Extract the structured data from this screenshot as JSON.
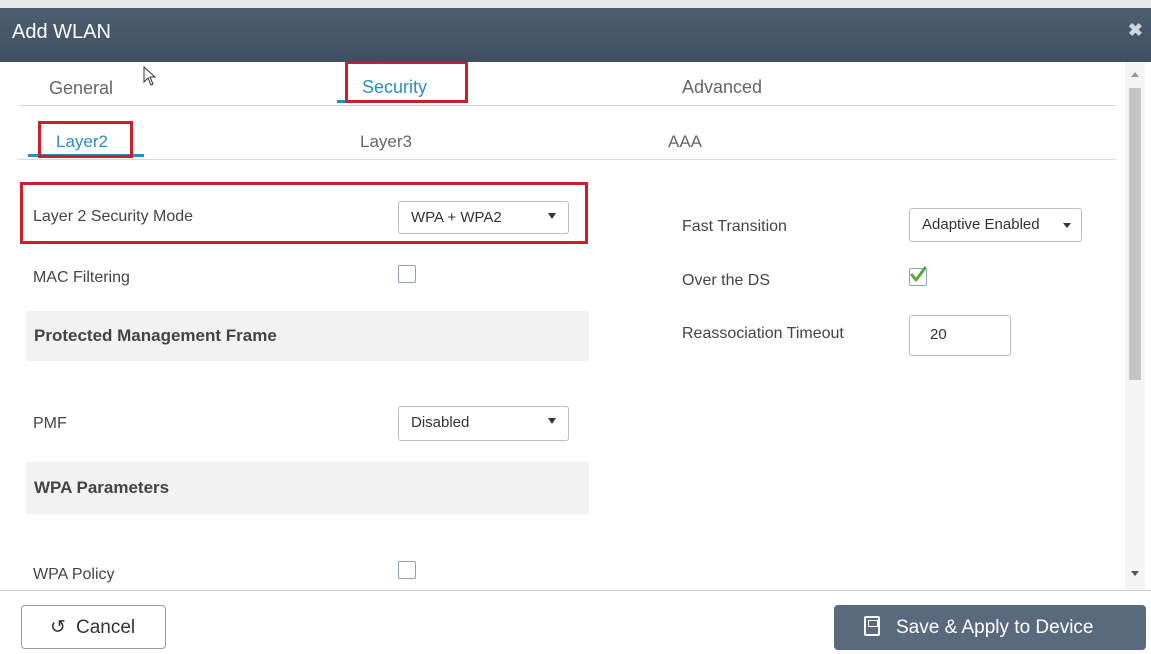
{
  "dialog": {
    "title": "Add WLAN",
    "close_glyph": "✖"
  },
  "tabs": [
    {
      "label": "General"
    },
    {
      "label": "Security"
    },
    {
      "label": "Advanced"
    }
  ],
  "subtabs": [
    {
      "label": "Layer2"
    },
    {
      "label": "Layer3"
    },
    {
      "label": "AAA"
    }
  ],
  "left": {
    "security_mode": {
      "label": "Layer 2 Security Mode",
      "value": "WPA + WPA2"
    },
    "mac_filtering": {
      "label": "MAC Filtering",
      "checked": false
    },
    "pmf_section": {
      "title": "Protected Management Frame"
    },
    "pmf": {
      "label": "PMF",
      "value": "Disabled"
    },
    "wpa_section": {
      "title": "WPA Parameters"
    },
    "wpa_policy": {
      "label": "WPA Policy",
      "checked": false
    }
  },
  "right": {
    "fast_transition": {
      "label": "Fast Transition",
      "value": "Adaptive Enabled"
    },
    "over_the_ds": {
      "label": "Over the DS",
      "checked": true
    },
    "reassociation_timeout": {
      "label": "Reassociation Timeout",
      "value": "20"
    }
  },
  "footer": {
    "cancel": {
      "label": "Cancel",
      "icon": "undo-icon"
    },
    "save": {
      "label": "Save & Apply to Device",
      "icon": "save-icon"
    }
  },
  "colors": {
    "titlebar": "#46566a",
    "accent": "#2a8fc0",
    "highlight": "#c8202b",
    "save_button": "#5a6a7e"
  }
}
